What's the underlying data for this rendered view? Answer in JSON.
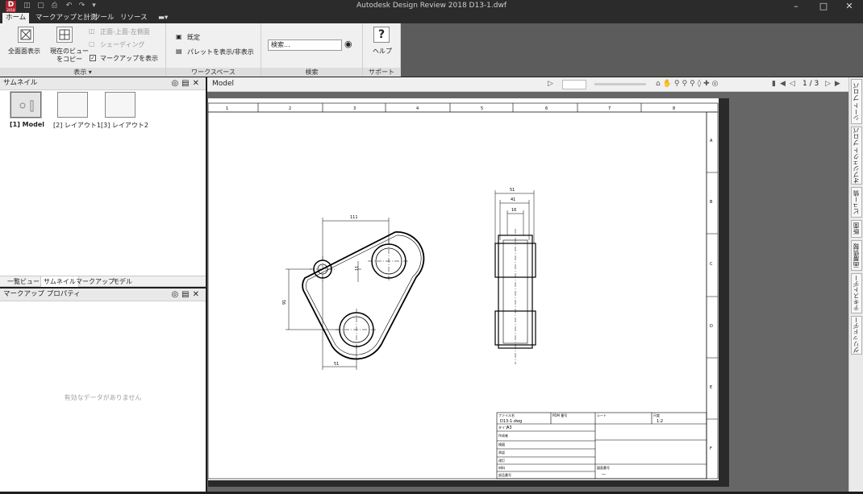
{
  "window": {
    "title": "Autodesk Design Review 2018   D13-1.dwf"
  },
  "app_icon": {
    "letter": "D",
    "sub": "2018"
  },
  "ribbon_tabs": [
    {
      "label": "ホーム",
      "active": true
    },
    {
      "label": "マークアップと計測"
    },
    {
      "label": "ツール"
    },
    {
      "label": "リソース"
    }
  ],
  "ribbon": {
    "view": {
      "fit_label": "全面面表示",
      "copy_label_1": "現在のビュー",
      "copy_label_2": "をコピー",
      "front_top": "正面-上面-左側面",
      "shading": "シェーディング",
      "markup_show": "マークアップを表示",
      "footer": "表示"
    },
    "workspace": {
      "default_label": "既定",
      "palette_label": "パレットを表示/非表示",
      "footer": "ワークスペース"
    },
    "search": {
      "placeholder": "検索...",
      "footer": "検索"
    },
    "support": {
      "help_label": "ヘルプ",
      "help_glyph": "?",
      "footer": "サポート"
    }
  },
  "thumbnail_panel": {
    "title": "サムネイル",
    "items": [
      {
        "label": "[1] Model",
        "selected": true
      },
      {
        "label": "[2] レイアウト1"
      },
      {
        "label": "[3] レイアウト2"
      }
    ]
  },
  "panel_tabs": [
    "一覧ビュー",
    "サムネイル",
    "マークアップ",
    "モデル"
  ],
  "markup_panel": {
    "title": "マークアップ プロパティ",
    "empty_text": "有効なデータがありません"
  },
  "view_toolbar": {
    "tab_label": "Model",
    "page_indicator": "1 / 3"
  },
  "right_tabs": [
    "シート プロパティ",
    "オブジェクト プロパティ",
    "ビュー情報",
    "断面",
    "画層情報",
    "テキストデータ",
    "グリッドデータ"
  ],
  "drawing": {
    "col_labels": [
      "1",
      "2",
      "3",
      "4",
      "5",
      "6",
      "7",
      "8"
    ],
    "row_labels": [
      "A",
      "B",
      "C",
      "D",
      "E",
      "F"
    ],
    "dims": {
      "top": "111",
      "vert_right": "11",
      "left": "91",
      "bottom": "51",
      "side_total": "51",
      "side_mid": "41",
      "side_inner": "16"
    },
    "titleblock": {
      "file_label": "ファイル名",
      "file_value": "D13-1.dwg",
      "type_label": "タイプ",
      "type_value": "A3",
      "pdm_label": "PDM 番号",
      "sheet_label": "シート",
      "scale_label": "尺度",
      "scale_value": "1:2",
      "drawn": "作成者",
      "checked": "検図",
      "approved": "承認",
      "date": "改訂",
      "material": "材料",
      "reference": "部品番号",
      "drawing_no": "図面番号",
      "dash": "―"
    }
  }
}
